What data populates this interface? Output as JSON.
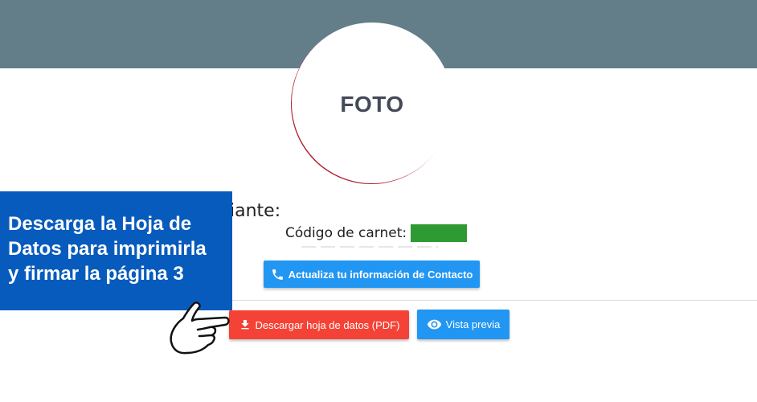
{
  "profile": {
    "photo_placeholder": "FOTO",
    "section_heading": "iante:",
    "carnet_label": "Código de carnet:",
    "carnet_value_color": "#2e9a33"
  },
  "buttons": {
    "contact_label": "Actualiza tu información de Contacto",
    "download_label": "Descargar hoja de datos (PDF)",
    "preview_label": "Vista previa"
  },
  "callout": {
    "lines": [
      "Descarga la Hoja de",
      "Datos para imprimirla",
      "y firmar la página 3"
    ]
  },
  "icons": {
    "contact": "phone-icon",
    "download": "download-icon",
    "preview": "eye-icon",
    "pointer": "pointing-hand-icon"
  },
  "colors": {
    "banner": "#637d89",
    "primary": "#2196f3",
    "danger": "#f44336",
    "callout": "#075bbd"
  }
}
